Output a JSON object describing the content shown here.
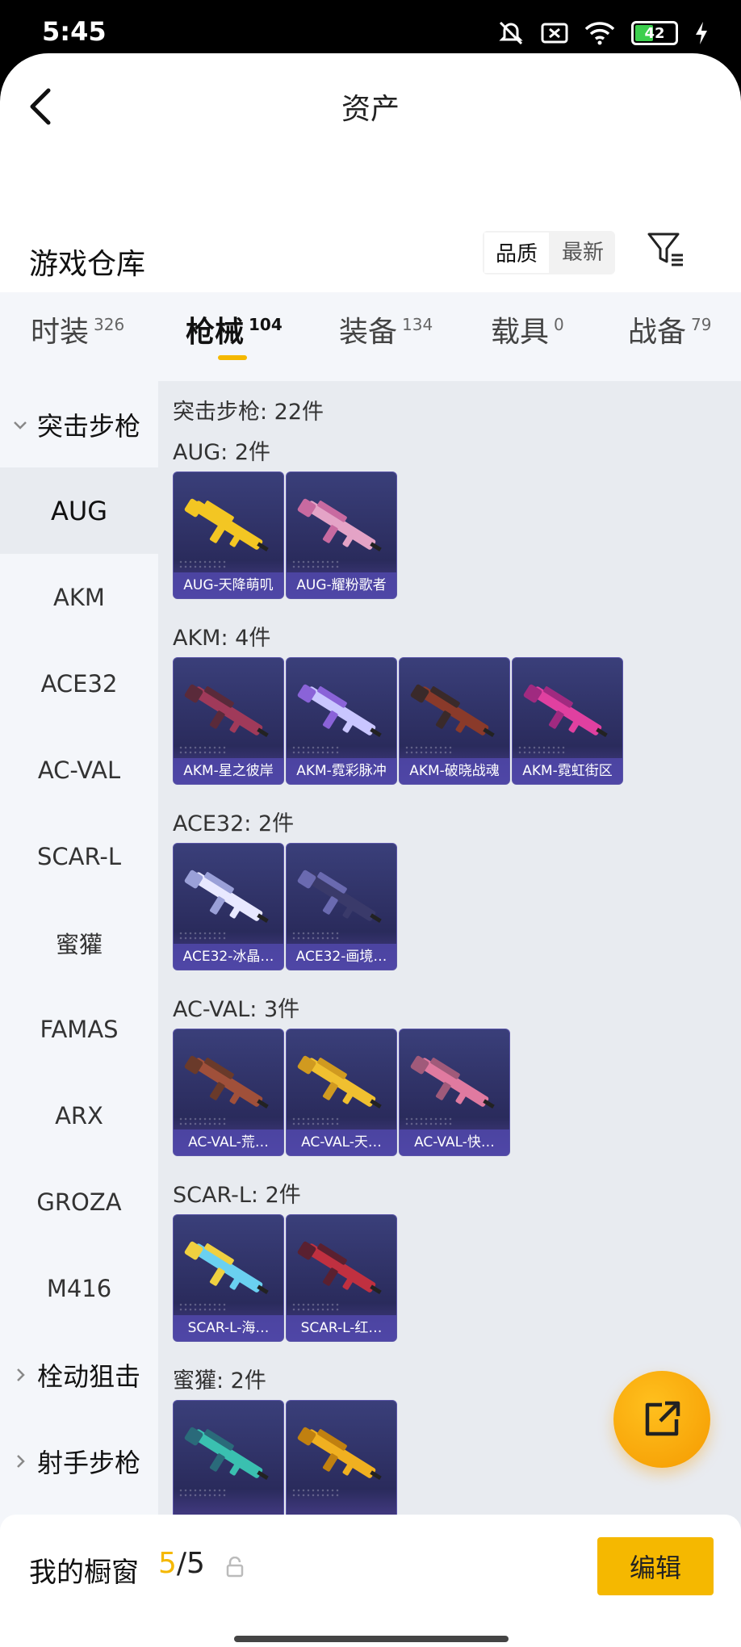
{
  "status_bar": {
    "time": "5:45",
    "battery": "42",
    "battery_level": 0.42
  },
  "header": {
    "title": "资产"
  },
  "section": {
    "name": "游戏仓库",
    "sort_options": [
      "品质",
      "最新"
    ]
  },
  "tabs": [
    {
      "label": "时装",
      "count": "326"
    },
    {
      "label": "枪械",
      "count": "104"
    },
    {
      "label": "装备",
      "count": "134"
    },
    {
      "label": "载具",
      "count": "0"
    },
    {
      "label": "战备",
      "count": "79"
    }
  ],
  "sidebar": {
    "group_open": "突击步枪",
    "items": [
      "AUG",
      "AKM",
      "ACE32",
      "AC-VAL",
      "SCAR-L",
      "蜜獾",
      "FAMAS",
      "ARX",
      "GROZA",
      "M416"
    ],
    "groups_closed": [
      "栓动狙击",
      "射手步枪"
    ]
  },
  "content": {
    "summary": "突击步枪: 22件",
    "categories": [
      {
        "label": "AUG: 2件",
        "items": [
          "AUG-天降萌叽",
          "AUG-耀粉歌者"
        ]
      },
      {
        "label": "AKM: 4件",
        "items": [
          "AKM-星之彼岸",
          "AKM-霓彩脉冲",
          "AKM-破晓战魂",
          "AKM-霓虹街区"
        ]
      },
      {
        "label": "ACE32: 2件",
        "items": [
          "ACE32-冰晶…",
          "ACE32-画境…"
        ]
      },
      {
        "label": "AC-VAL: 3件",
        "items": [
          "AC-VAL-荒…",
          "AC-VAL-天…",
          "AC-VAL-快…"
        ]
      },
      {
        "label": "SCAR-L: 2件",
        "items": [
          "SCAR-L-海…",
          "SCAR-L-红…"
        ]
      },
      {
        "label": "蜜獾: 2件",
        "items": [
          "",
          ""
        ]
      }
    ]
  },
  "bottom_bar": {
    "label": "我的橱窗",
    "count_current": "5",
    "count_total": "/5",
    "edit": "编辑"
  }
}
